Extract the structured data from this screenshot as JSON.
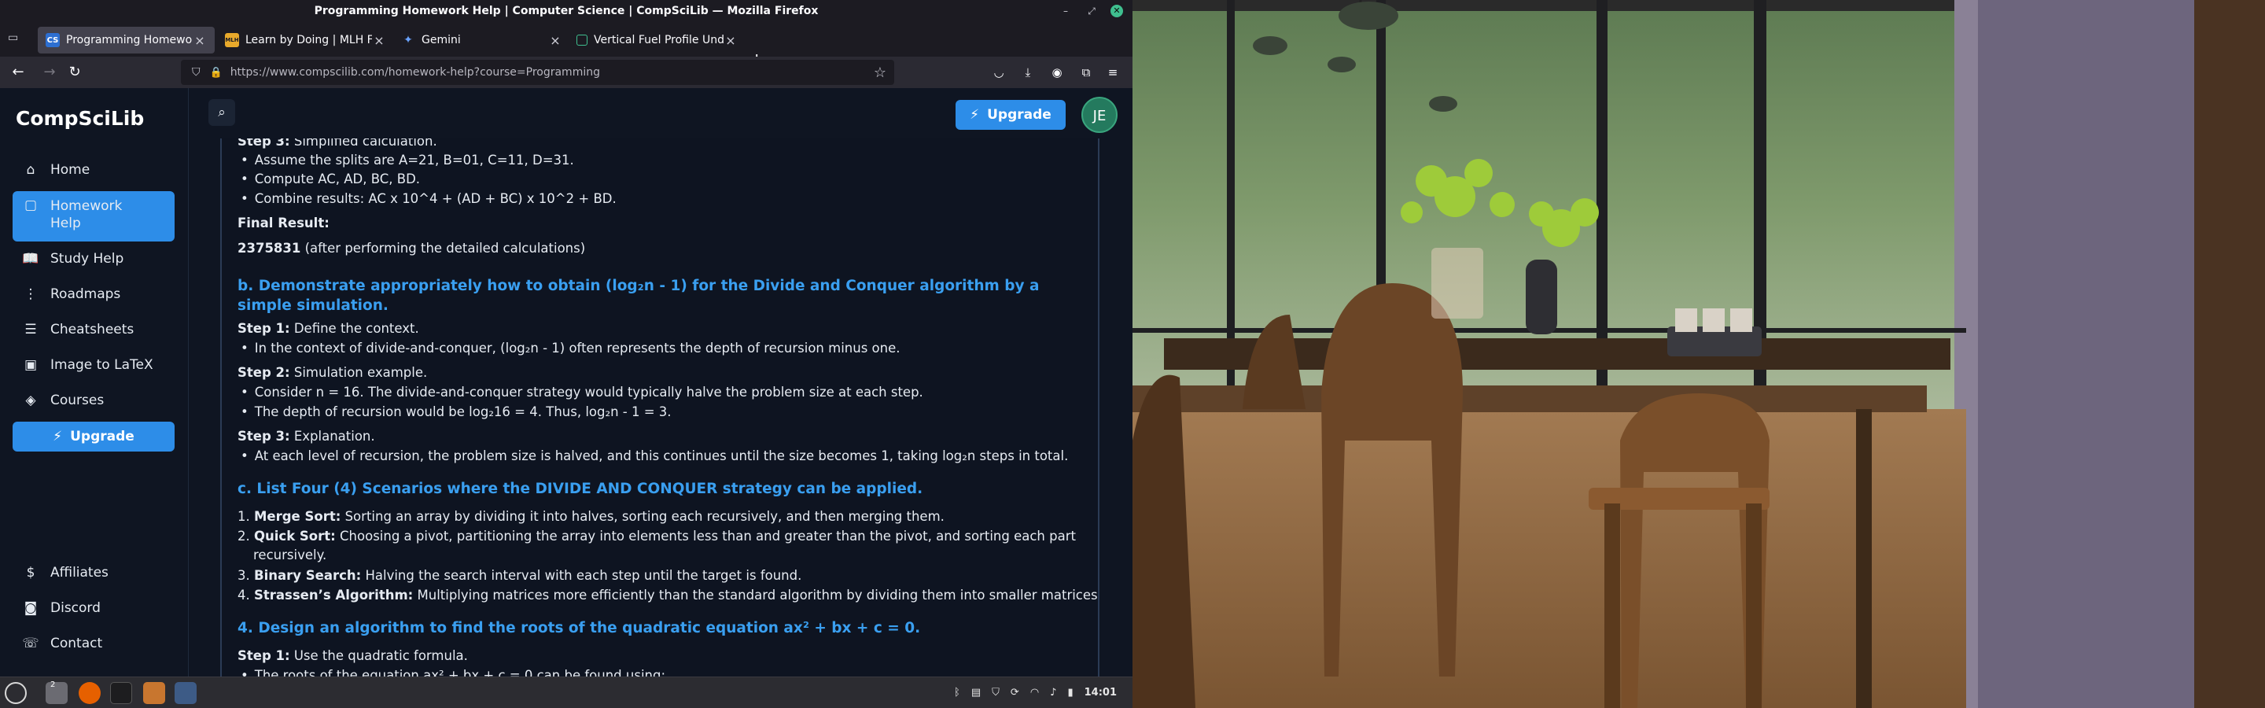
{
  "window": {
    "title": "Programming Homework Help | Computer Science | CompSciLib — Mozilla Firefox"
  },
  "tabs": [
    {
      "label": "Programming Homework H",
      "favicon": "CS",
      "active": true
    },
    {
      "label": "Learn by Doing | MLH Fello",
      "favicon": "MLH",
      "active": false
    },
    {
      "label": "Gemini",
      "favicon": "✦",
      "active": false
    },
    {
      "label": "Vertical Fuel Profile Unders",
      "favicon": "doc",
      "active": false
    }
  ],
  "nav": {
    "url": "https://www.compscilib.com/homework-help?course=Programming"
  },
  "app": {
    "logo": "CompSciLib",
    "sidebar": {
      "items": [
        {
          "label": "Home",
          "icon": "home-icon"
        },
        {
          "label": "Homework Help",
          "icon": "chat-icon"
        },
        {
          "label": "Study Help",
          "icon": "book-icon"
        },
        {
          "label": "Roadmaps",
          "icon": "roadmap-icon"
        },
        {
          "label": "Cheatsheets",
          "icon": "sheet-icon"
        },
        {
          "label": "Image to LaTeX",
          "icon": "image-icon"
        },
        {
          "label": "Courses",
          "icon": "courses-icon"
        }
      ],
      "upgrade": "Upgrade",
      "bottom": [
        {
          "label": "Affiliates",
          "icon": "dollar-icon"
        },
        {
          "label": "Discord",
          "icon": "discord-icon"
        },
        {
          "label": "Contact",
          "icon": "contact-icon"
        }
      ]
    },
    "topbar": {
      "upgrade": "Upgrade",
      "avatar": "JE"
    }
  },
  "content": {
    "s3_label": "Step 3:",
    "s3_text": " Simplified calculation.",
    "b1": "Assume the splits are A=21, B=01, C=11, D=31.",
    "b2": "Compute AC, AD, BC, BD.",
    "b3": "Combine results: AC x 10^4 + (AD + BC) x 10^2 + BD.",
    "final_label": "Final Result:",
    "final_value": "2375831",
    "final_note": " (after performing the detailed calculations)",
    "hb": "b. Demonstrate appropriately how to obtain (log₂n - 1) for the Divide and Conquer algorithm by a simple simulation.",
    "b_s1_label": "Step 1:",
    "b_s1_text": " Define the context.",
    "b_s1_b1": "In the context of divide-and-conquer, (log₂n - 1) often represents the depth of recursion minus one.",
    "b_s2_label": "Step 2:",
    "b_s2_text": " Simulation example.",
    "b_s2_b1": "Consider n = 16. The divide-and-conquer strategy would typically halve the problem size at each step.",
    "b_s2_b2": "The depth of recursion would be log₂16 = 4. Thus, log₂n - 1 = 3.",
    "b_s3_label": "Step 3:",
    "b_s3_text": " Explanation.",
    "b_s3_b1": "At each level of recursion, the problem size is halved, and this continues until the size becomes 1, taking log₂n steps in total.",
    "hc": "c. List Four (4) Scenarios where the DIVIDE AND CONQUER strategy can be applied.",
    "c1_label": "Merge Sort:",
    "c1_text": " Sorting an array by dividing it into halves, sorting each recursively, and then merging them.",
    "c2_label": "Quick Sort:",
    "c2_text": " Choosing a pivot, partitioning the array into elements less than and greater than the pivot, and sorting each part",
    "c2_text2": "recursively.",
    "c3_label": "Binary Search:",
    "c3_text": " Halving the search interval with each step until the target is found.",
    "c4_label": "Strassen’s Algorithm:",
    "c4_text": " Multiplying matrices more efficiently than the standard algorithm by dividing them into smaller matrices.",
    "h4": "4. Design an algorithm to find the roots of the quadratic equation ax² + bx + c = 0.",
    "d_s1_label": "Step 1:",
    "d_s1_text": " Use the quadratic formula.",
    "d_s1_b1": "The roots of the equation ax² + bx + c = 0 can be found using:"
  },
  "taskbar": {
    "clock": "14:01",
    "workspace": "2"
  },
  "colors": {
    "accent": "#2d8de8",
    "heading": "#3a9ff0",
    "page_bg": "#0f1522"
  }
}
